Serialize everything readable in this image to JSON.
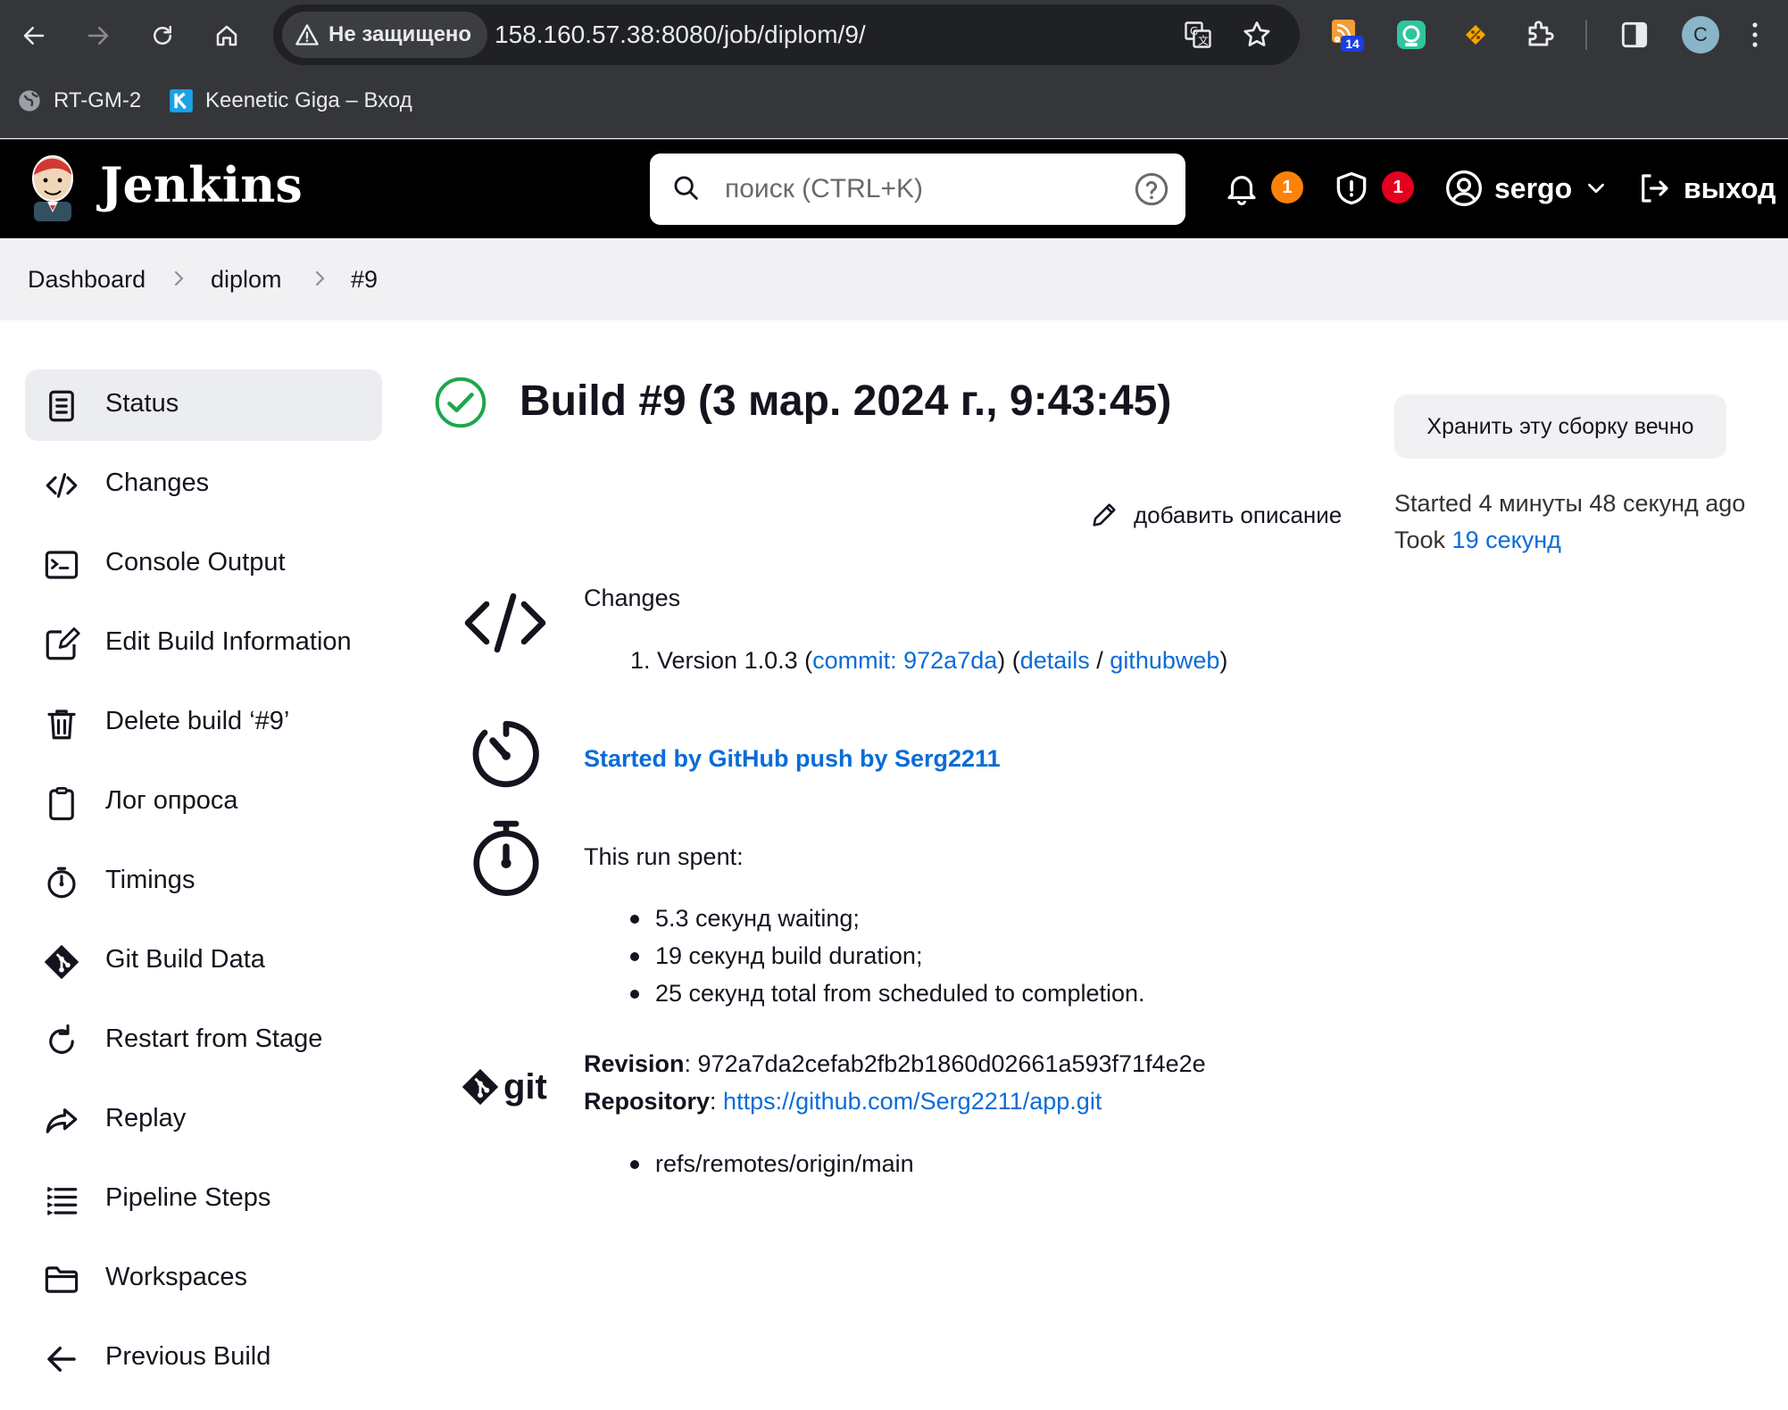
{
  "browser": {
    "security_label": "Не защищено",
    "url": "158.160.57.38:8080/job/diplom/9/",
    "ext_badge": "14",
    "profile_initial": "C",
    "bookmarks": [
      {
        "label": "RT-GM-2"
      },
      {
        "label": "Keenetic Giga – Вход"
      }
    ]
  },
  "header": {
    "brand": "Jenkins",
    "search_placeholder": "поиск (CTRL+K)",
    "notifications_count": "1",
    "security_count": "1",
    "user": "sergo",
    "logout": "выход",
    "colors": {
      "notif_badge": "#fe820a",
      "security_badge": "#e6001f"
    }
  },
  "breadcrumb": {
    "items": [
      "Dashboard",
      "diplom",
      "#9"
    ]
  },
  "sidebar": {
    "items": [
      {
        "label": "Status",
        "icon": "document-icon"
      },
      {
        "label": "Changes",
        "icon": "code-icon"
      },
      {
        "label": "Console Output",
        "icon": "terminal-icon"
      },
      {
        "label": "Edit Build Information",
        "icon": "edit-icon"
      },
      {
        "label": "Delete build ‘#9’",
        "icon": "trash-icon"
      },
      {
        "label": "Лог опроса",
        "icon": "clipboard-icon"
      },
      {
        "label": "Timings",
        "icon": "stopwatch-icon"
      },
      {
        "label": "Git Build Data",
        "icon": "git-icon"
      },
      {
        "label": "Restart from Stage",
        "icon": "restart-icon"
      },
      {
        "label": "Replay",
        "icon": "replay-icon"
      },
      {
        "label": "Pipeline Steps",
        "icon": "list-icon"
      },
      {
        "label": "Workspaces",
        "icon": "folder-icon"
      },
      {
        "label": "Previous Build",
        "icon": "arrow-left-icon"
      }
    ]
  },
  "build": {
    "title": "Build #9 (3 мар. 2024 г., 9:43:45)",
    "keep_button": "Хранить эту сборку вечно",
    "started_prefix": "Started ",
    "started_value": "4 минуты 48 секунд ago",
    "took_prefix": "Took ",
    "took_link": "19 секунд",
    "add_description": "добавить описание",
    "changes": {
      "heading": "Changes",
      "item_prefix": "1. Version 1.0.3 (",
      "commit_link": "commit: 972a7da",
      "mid1": ") (",
      "details_link": "details",
      "sep": " / ",
      "githubweb_link": "githubweb",
      "end": ")"
    },
    "cause": "Started by GitHub push by Serg2211",
    "timings": {
      "heading": "This run spent:",
      "items": [
        "5.3 секунд waiting;",
        "19 секунд build duration;",
        "25 секунд total from scheduled to completion."
      ]
    },
    "git": {
      "logo_text": "git",
      "revision_label": "Revision",
      "revision_value": ": 972a7da2cefab2fb2b1860d02661a593f71f4e2e",
      "repository_label": "Repository",
      "repository_colon": ": ",
      "repository_link": "https://github.com/Serg2211/app.git",
      "branches": [
        "refs/remotes/origin/main"
      ]
    }
  },
  "colors": {
    "success": "#1ea64b",
    "link": "#0b6cd6"
  }
}
